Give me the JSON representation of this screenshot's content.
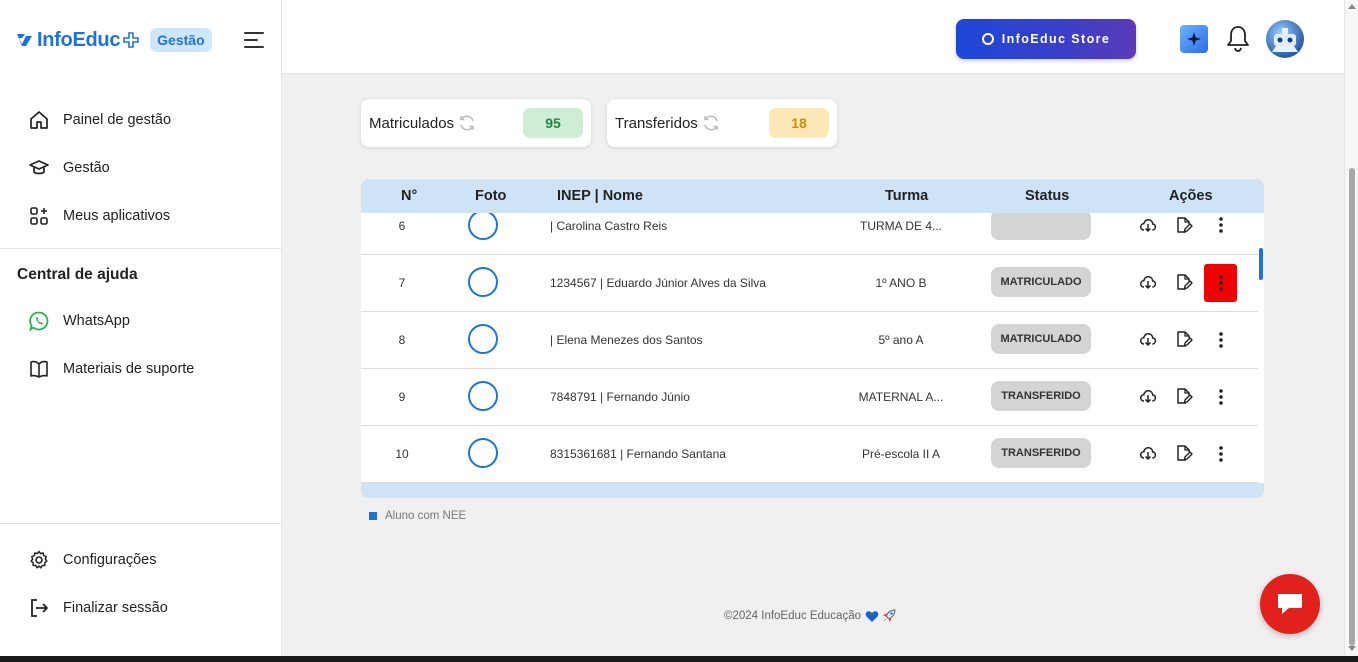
{
  "brand": {
    "name": "InfoEduc",
    "tag": "Gestão",
    "color": "#1e74d6"
  },
  "sidebar": {
    "items": [
      {
        "label": "Painel de gestão",
        "icon": "home-icon"
      },
      {
        "label": "Gestão",
        "icon": "graduation-cap-icon"
      },
      {
        "label": "Meus aplicativos",
        "icon": "apps-grid-icon"
      }
    ],
    "help_title": "Central de ajuda",
    "help_items": [
      {
        "label": "WhatsApp",
        "icon": "whatsapp-icon"
      },
      {
        "label": "Materiais de suporte",
        "icon": "book-icon"
      }
    ],
    "bottom_items": [
      {
        "label": "Configurações",
        "icon": "gear-icon"
      },
      {
        "label": "Finalizar sessão",
        "icon": "logout-icon"
      }
    ]
  },
  "topbar": {
    "store_label": "InfoEduc Store"
  },
  "stats": {
    "enrolled": {
      "label": "Matriculados",
      "value": "95",
      "bg": "#cdeed5",
      "color": "#1a8a3a"
    },
    "transferred": {
      "label": "Transferidos",
      "value": "18",
      "bg": "#fde9b8",
      "color": "#d18d00"
    }
  },
  "table": {
    "headers": {
      "no": "N°",
      "photo": "Foto",
      "name": "INEP | Nome",
      "class": "Turma",
      "status": "Status",
      "actions": "Ações"
    },
    "rows": [
      {
        "no": "6",
        "name": " | Carolina Castro Reis",
        "class": "TURMA DE 4...",
        "status": ""
      },
      {
        "no": "7",
        "name": "1234567 | Eduardo Júnior Alves da Silva",
        "class": "1º ANO B",
        "status": "MATRICULADO"
      },
      {
        "no": "8",
        "name": " | Elena Menezes dos Santos",
        "class": "5º ano A",
        "status": "MATRICULADO"
      },
      {
        "no": "9",
        "name": "7848791 | Fernando Júnio",
        "class": "MATERNAL A...",
        "status": "TRANSFERIDO"
      },
      {
        "no": "10",
        "name": "8315361681 | Fernando Santana",
        "class": "Pré-escola II A",
        "status": "TRANSFERIDO"
      }
    ]
  },
  "legend": {
    "label": "Aluno com NEE"
  },
  "footer": {
    "text": "©2024 InfoEduc Educação"
  }
}
